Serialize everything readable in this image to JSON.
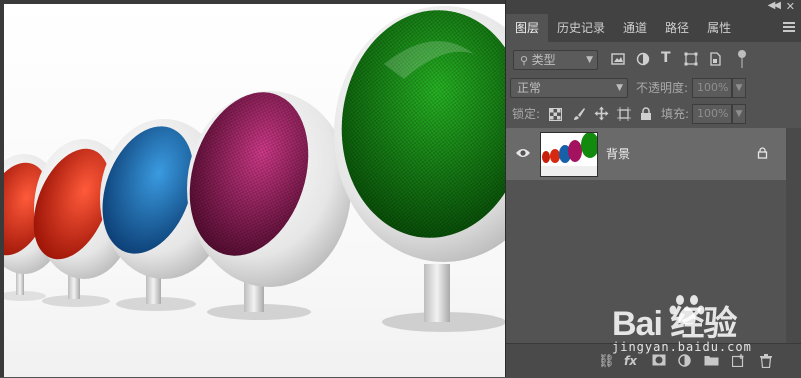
{
  "panel": {
    "tabs": [
      {
        "label": "图层",
        "active": true
      },
      {
        "label": "历史记录"
      },
      {
        "label": "通道"
      },
      {
        "label": "路径"
      },
      {
        "label": "属性"
      }
    ],
    "filter": {
      "kind_label": "类型"
    },
    "blend": {
      "mode": "正常",
      "opacity_label": "不透明度:",
      "opacity_value": "100%"
    },
    "lock": {
      "label": "锁定:",
      "fill_label": "填充:",
      "fill_value": "100%"
    },
    "layer": {
      "name": "背景",
      "visible": true,
      "locked": true
    }
  },
  "watermark": {
    "brand": "Bai  经验",
    "url": "jingyan.baidu.com"
  },
  "colors": {
    "panel_bg": "#535353",
    "tab_bar_bg": "#424242",
    "selected_layer_bg": "#6a6a6a",
    "chair_red": "#d62a10",
    "chair_blue": "#1560a8",
    "chair_magenta": "#a3115f",
    "chair_green": "#118a0e"
  },
  "icons": [
    "collapse-arrows-icon",
    "close-icon",
    "panel-menu-icon",
    "image-filter-icon",
    "adjustment-filter-icon",
    "type-filter-icon",
    "shape-filter-icon",
    "smart-object-filter-icon",
    "filter-toggle-icon",
    "lock-transparent-icon",
    "lock-paint-icon",
    "lock-move-icon",
    "lock-artboard-icon",
    "lock-all-icon",
    "eye-icon",
    "layer-lock-icon",
    "link-icon",
    "fx-icon",
    "mask-icon",
    "adjustment-icon",
    "group-icon",
    "new-layer-icon",
    "trash-icon"
  ]
}
